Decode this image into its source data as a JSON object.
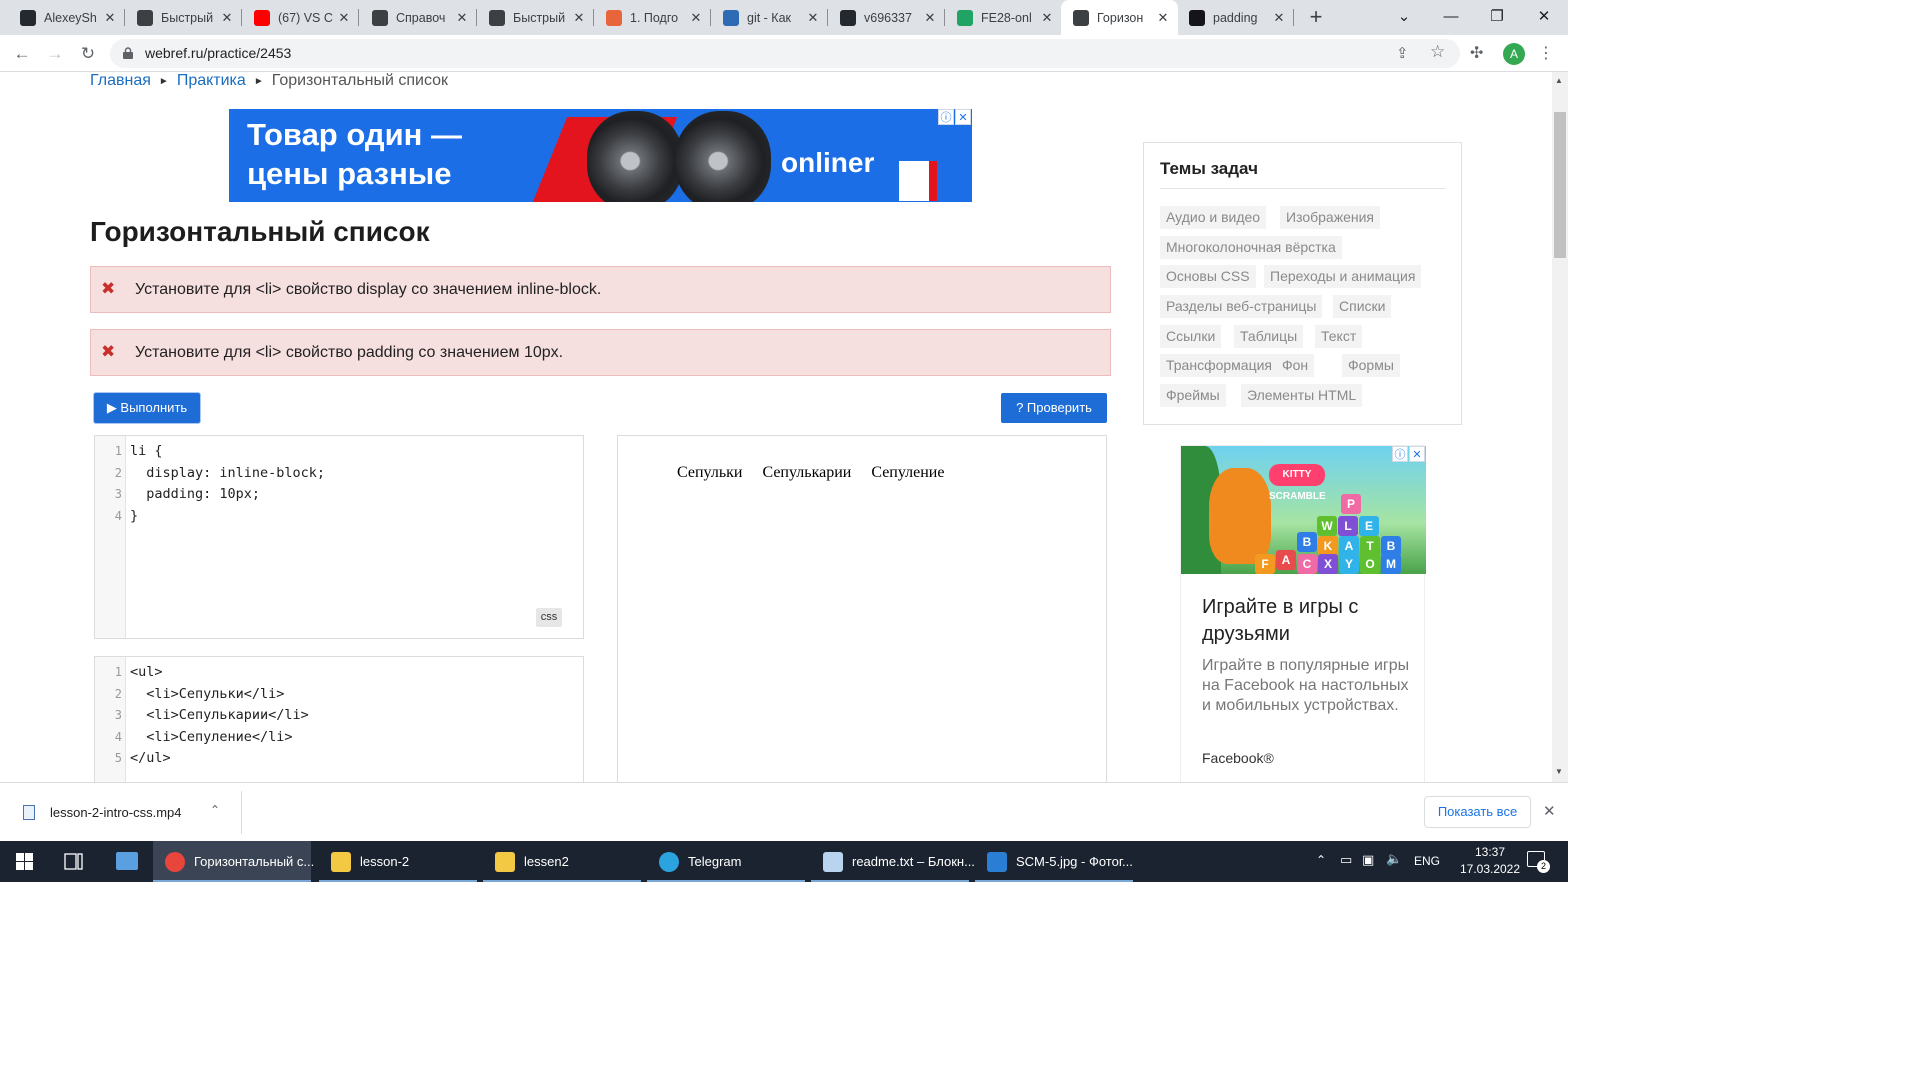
{
  "browser": {
    "tabs": [
      {
        "title": "AlexeySh",
        "icon": "github-icon",
        "color": "#24292f"
      },
      {
        "title": "Быстрый",
        "icon": "page-icon",
        "color": "#3c4043"
      },
      {
        "title": "(67) VS C",
        "icon": "youtube-icon",
        "color": "#ff0000"
      },
      {
        "title": "Справоч",
        "icon": "chat-icon",
        "color": "#3c4043"
      },
      {
        "title": "Быстрый",
        "icon": "page-icon",
        "color": "#3c4043"
      },
      {
        "title": "1. Подго",
        "icon": "hand-icon",
        "color": "#e8643a"
      },
      {
        "title": "git - Как",
        "icon": "stackoverflow-icon",
        "color": "#2e6bb5"
      },
      {
        "title": "v696337",
        "icon": "github-icon",
        "color": "#24292f"
      },
      {
        "title": "FE28-onl",
        "icon": "drive-icon",
        "color": "#1fa463"
      },
      {
        "title": "Горизон",
        "icon": "chat-icon",
        "color": "#3c4043",
        "active": true
      },
      {
        "title": "padding",
        "icon": "mdn-icon",
        "color": "#15141a"
      }
    ],
    "url": "webref.ru/practice/2453",
    "avatar_letter": "A"
  },
  "page": {
    "breadcrumb": [
      {
        "label": "Главная",
        "link": true
      },
      {
        "label": "Практика",
        "link": true
      },
      {
        "label": "Горизонтальный список",
        "link": false
      }
    ],
    "ad_banner": {
      "line1": "Товар один —",
      "line2": "цены разные",
      "brand": "onliner"
    },
    "title": "Горизонтальный список",
    "alerts": [
      {
        "icon": "error-x-icon",
        "message": "Установите для <li> свойство display со значением inline-block."
      },
      {
        "icon": "error-x-icon",
        "message": "Установите для <li> свойство padding со значением 10px."
      }
    ],
    "run_button": "▶ Выполнить",
    "check_button": "? Проверить",
    "css_editor": {
      "line_numbers": [
        "1",
        "2",
        "3",
        "4"
      ],
      "lines": [
        "li {",
        "  display: inline-block;",
        "  padding: 10px;",
        "}"
      ],
      "language_badge": "css"
    },
    "html_editor": {
      "line_numbers": [
        "1",
        "2",
        "3",
        "4",
        "5"
      ],
      "lines": [
        "<ul>",
        "  <li>Сепульки</li>",
        "  <li>Сепулькарии</li>",
        "  <li>Сепуление</li>",
        "</ul>"
      ]
    },
    "preview_items": [
      "Сепульки",
      "Сепулькарии",
      "Сепуление"
    ],
    "topics": {
      "heading": "Темы задач",
      "tags": [
        "Аудио и видео",
        "Изображения",
        "Многоколоночная вёрстка",
        "Основы CSS",
        "Переходы и анимация",
        "Разделы веб-страницы",
        "Списки",
        "Ссылки",
        "Таблицы",
        "Текст",
        "Трансформация",
        "Фон",
        "Формы",
        "Фреймы",
        "Элементы HTML"
      ]
    },
    "side_ad": {
      "game_logo": "KITTY SCRAMBLE",
      "letters": [
        "P",
        "W",
        "L",
        "E",
        "B",
        "K",
        "A",
        "T",
        "B",
        "A",
        "C",
        "X",
        "Y",
        "O",
        "M",
        "F"
      ],
      "headline": "Играйте в игры с друзьями",
      "body": "Играйте в популярные игры на Facebook на настольных и мобильных устройствах.",
      "brand": "Facebook®"
    }
  },
  "download_bar": {
    "file_name": "lesson-2-intro-css.mp4",
    "show_all": "Показать все"
  },
  "taskbar": {
    "items": [
      {
        "label": "Горизонтальный с...",
        "icon": "chrome-icon",
        "color": "#e8453c",
        "active": true
      },
      {
        "label": "lesson-2",
        "icon": "folder-icon",
        "color": "#f3c843"
      },
      {
        "label": "lessen2",
        "icon": "folder-icon",
        "color": "#f3c843"
      },
      {
        "label": "Telegram",
        "icon": "telegram-icon",
        "color": "#2aa3de"
      },
      {
        "label": "readme.txt – Блокн...",
        "icon": "notepad-icon",
        "color": "#b9d4ee"
      },
      {
        "label": "SCM-5.jpg - Фотог...",
        "icon": "photos-icon",
        "color": "#2a7fd4"
      }
    ],
    "language": "ENG",
    "time": "13:37",
    "date": "17.03.2022",
    "notifications": "2"
  }
}
